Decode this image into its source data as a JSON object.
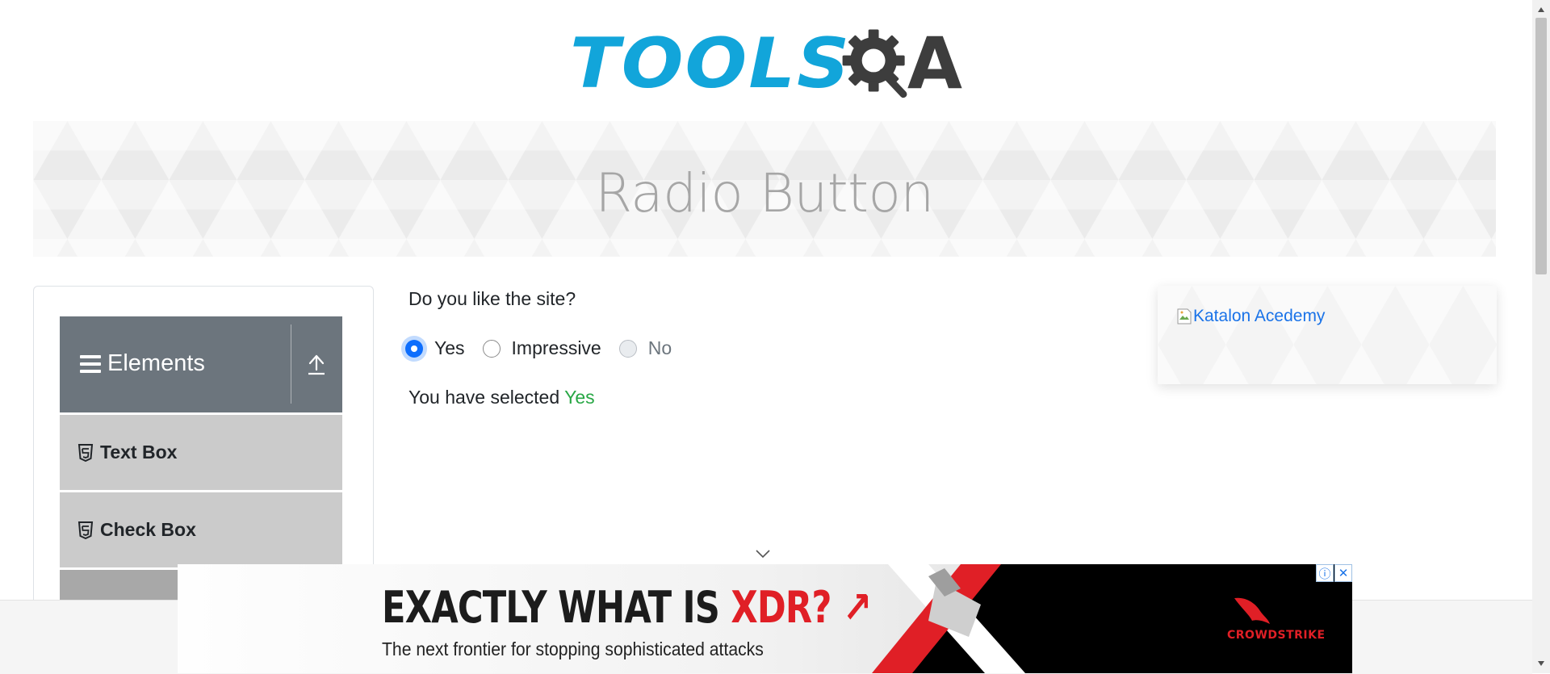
{
  "header": {
    "logo_text_left": "TOOLS",
    "logo_text_right": "A"
  },
  "banner": {
    "title": "Radio Button"
  },
  "sidebar": {
    "group_title": "Elements",
    "items": [
      {
        "label": "Text Box",
        "icon": "html5-icon"
      },
      {
        "label": "Check Box",
        "icon": "html5-icon"
      },
      {
        "label": "",
        "icon": "html5-icon"
      }
    ]
  },
  "main": {
    "question": "Do you like the site?",
    "options": [
      {
        "label": "Yes",
        "checked": true,
        "disabled": false
      },
      {
        "label": "Impressive",
        "checked": false,
        "disabled": false
      },
      {
        "label": "No",
        "checked": false,
        "disabled": true
      }
    ],
    "result_prefix": "You have selected ",
    "result_value": "Yes"
  },
  "right_ad": {
    "link_text": "Katalon Acedemy"
  },
  "bottom_ad": {
    "headline_part1": "EXACTLY WHAT IS ",
    "headline_highlight": "XDR? ↗",
    "subline": "The next frontier for stopping sophisticated attacks",
    "brand": "CROWDSTRIKE",
    "info_icon": "ⓘ",
    "close_icon": "✕"
  },
  "colors": {
    "accent_blue": "#0d6efd",
    "selected_green": "#28a745",
    "logo_blue": "#12a5da",
    "sidebar_header": "#6c757d",
    "ad_red": "#e01f26"
  }
}
